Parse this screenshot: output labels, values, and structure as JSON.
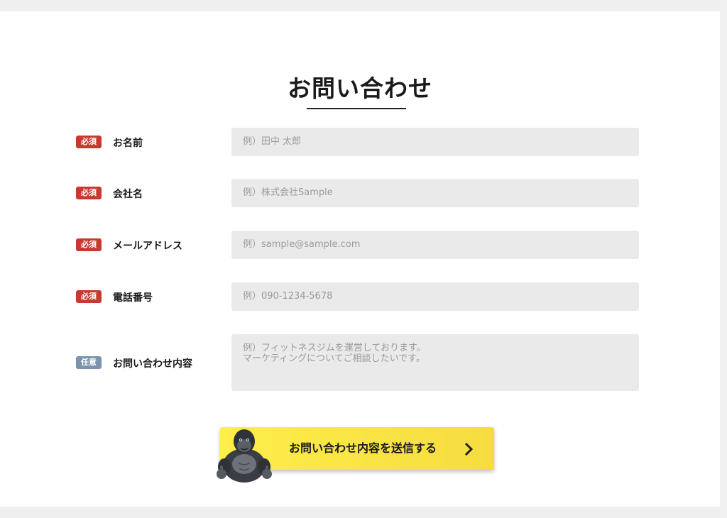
{
  "page": {
    "title": "お問い合わせ"
  },
  "form": {
    "fields": [
      {
        "badge": "必須",
        "badge_type": "required",
        "label": "お名前",
        "placeholder": "例）田中 太郎"
      },
      {
        "badge": "必須",
        "badge_type": "required",
        "label": "会社名",
        "placeholder": "例）株式会社Sample"
      },
      {
        "badge": "必須",
        "badge_type": "required",
        "label": "メールアドレス",
        "placeholder": "例）sample@sample.com"
      },
      {
        "badge": "必須",
        "badge_type": "required",
        "label": "電話番号",
        "placeholder": "例）090-1234-5678"
      },
      {
        "badge": "任意",
        "badge_type": "optional",
        "label": "お問い合わせ内容",
        "placeholder": "例）フィットネスジムを運営しております。\nマーケティングについてご相談したいです。"
      }
    ],
    "submit_label": "お問い合わせ内容を送信する",
    "submit_icon": "chevron-right-icon",
    "mascot_icon": "gorilla-mascot-icon"
  },
  "colors": {
    "required_badge": "#c8392f",
    "optional_badge": "#7a94ad",
    "field_background": "#eaeaea",
    "button_yellow": "#fdee4a"
  }
}
